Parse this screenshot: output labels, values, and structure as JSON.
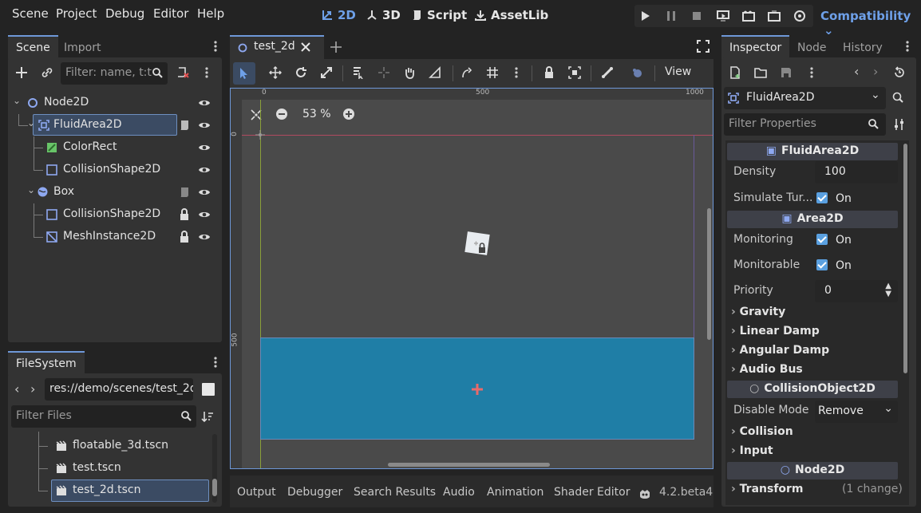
{
  "menu": [
    "Scene",
    "Project",
    "Debug",
    "Editor",
    "Help"
  ],
  "workspaces": {
    "w2d": "2D",
    "w3d": "3D",
    "script": "Script",
    "assetlib": "AssetLib"
  },
  "renderer": "Compatibility",
  "scene_dock": {
    "tabs": [
      "Scene",
      "Import"
    ],
    "filter_placeholder": "Filter: name, t:t",
    "tree": [
      {
        "label": "Node2D"
      },
      {
        "label": "FluidArea2D"
      },
      {
        "label": "ColorRect"
      },
      {
        "label": "CollisionShape2D"
      },
      {
        "label": "Box"
      },
      {
        "label": "CollisionShape2D"
      },
      {
        "label": "MeshInstance2D"
      }
    ]
  },
  "filesystem": {
    "tab": "FileSystem",
    "path": "res://demo/scenes/test_2d.",
    "filter_placeholder": "Filter Files",
    "items": [
      "floatable_3d.tscn",
      "test.tscn",
      "test_2d.tscn"
    ]
  },
  "editor": {
    "tab": "test_2d",
    "view_label": "View",
    "zoom": "53 %",
    "ruler": {
      "h500": "500",
      "h1000": "1000",
      "h0": "0",
      "v0": "0",
      "v500": "500"
    }
  },
  "bottom": {
    "tabs": [
      "Output",
      "Debugger",
      "Search Results",
      "Audio",
      "Animation",
      "Shader Editor"
    ],
    "version": "4.2.beta4"
  },
  "inspector": {
    "tabs": [
      "Inspector",
      "Node",
      "History"
    ],
    "node_name": "FluidArea2D",
    "filter_placeholder": "Filter Properties",
    "sections": {
      "fluid": "FluidArea2D",
      "area": "Area2D",
      "collision": "CollisionObject2D",
      "node2d": "Node2D"
    },
    "props": {
      "density_label": "Density",
      "density_value": "100",
      "simturb_label": "Simulate Tur...",
      "simturb_value": "On",
      "monitoring_label": "Monitoring",
      "monitoring_value": "On",
      "monitorable_label": "Monitorable",
      "monitorable_value": "On",
      "priority_label": "Priority",
      "priority_value": "0",
      "disable_label": "Disable Mode",
      "disable_value": "Remove"
    },
    "groups": {
      "gravity": "Gravity",
      "linear": "Linear Damp",
      "angular": "Angular Damp",
      "audio": "Audio Bus",
      "collision": "Collision",
      "input": "Input",
      "transform": "Transform",
      "transform_note": "(1 change)"
    }
  },
  "colors": {
    "accent": "#6e98d8",
    "water": "#1f7ea6",
    "canvas": "#4a4a4a"
  }
}
